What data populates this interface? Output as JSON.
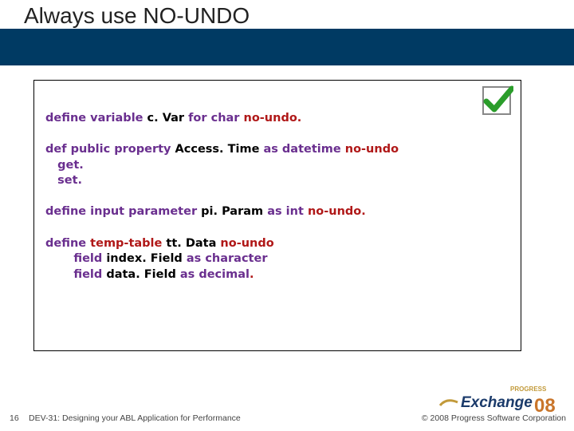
{
  "title": "Always use NO-UNDO",
  "code": {
    "line1": {
      "a": "define variable",
      "b": " c. Var ",
      "c": "for char",
      "d": " no-undo."
    },
    "line2": {
      "a": "def public property",
      "b": " Access. Time ",
      "c": "as datetime",
      "d": " no-undo"
    },
    "line3": "   get.",
    "line4": "   set.",
    "line5": {
      "a": "define input parameter",
      "b": " pi. Param ",
      "c": "as int",
      "d": " no-undo."
    },
    "line6": {
      "a": "define",
      "b": " temp-table ",
      "c": "tt. Data",
      "d": " no-undo"
    },
    "line7": {
      "a": "       field",
      "b": " index. Field ",
      "c": "as character"
    },
    "line8": {
      "a": "       field",
      "b": " data. Field ",
      "c": "as decimal",
      "d": "."
    }
  },
  "footer": {
    "page": "16",
    "title": "DEV-31: Designing your ABL Application for Performance",
    "copyright": "© 2008 Progress Software Corporation"
  },
  "logo": {
    "top": "PROGRESS",
    "mid": "Exchange",
    "year": "08"
  }
}
